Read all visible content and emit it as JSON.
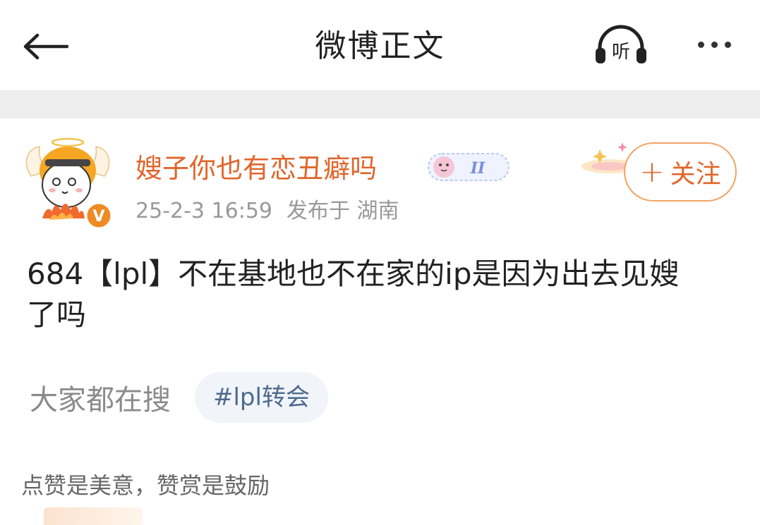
{
  "header": {
    "title": "微博正文",
    "listen_label": "听"
  },
  "post": {
    "username": "嫂子你也有恋丑癖吗",
    "member_badge_text": "II",
    "timestamp": "25-2-3 16:59",
    "location": "发布于 湖南",
    "verified_mark": "V",
    "follow_label": "关注",
    "follow_plus": "+",
    "content_line1": "684【lpl】不在基地也不在家的ip是因为出去见嫂",
    "content_line2": "了吗"
  },
  "hot_search": {
    "label": "大家都在搜",
    "tag": "#lpl转会"
  },
  "reward": {
    "text": "点赞是美意，赞赏是鼓励"
  },
  "colors": {
    "accent": "#e0662b",
    "follow_border": "#f0a463",
    "tag_text": "#4d6a8f",
    "tag_bg": "#f1f4f9",
    "divider": "#ededed"
  }
}
